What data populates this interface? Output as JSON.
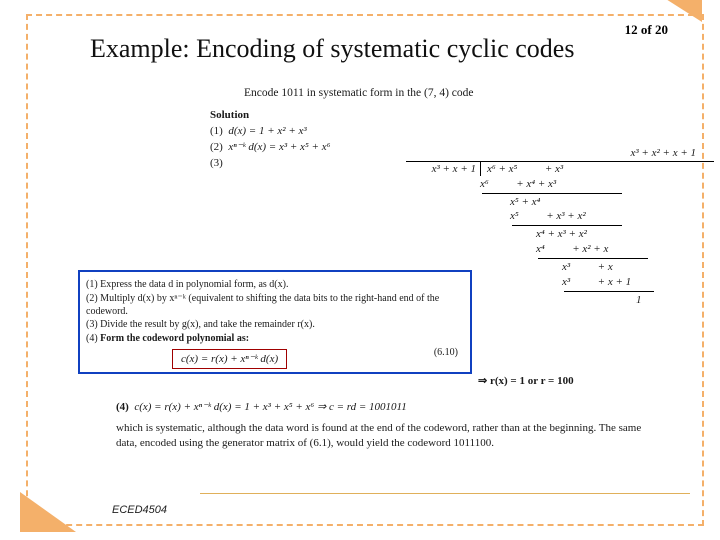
{
  "page_indicator": "12 of 20",
  "title": "Example: Encoding of systematic cyclic codes",
  "task": "Encode 1011 in systematic form in the (7, 4) code",
  "solution": {
    "header": "Solution",
    "line1_label": "(1)",
    "line1_expr": "d(x) = 1 + x² + x³",
    "line2_label": "(2)",
    "line2_expr": "xⁿ⁻ᵏ d(x) = x³ + x⁵ + x⁶",
    "line3_label": "(3)"
  },
  "longdiv": {
    "quotient": "x³ + x² + x + 1",
    "divisor": "x³ + x + 1",
    "dividend": "x⁶ + x⁵    + x³",
    "s1": "x⁶    + x⁴ + x³",
    "r1": "x⁵ + x⁴",
    "s2": "x⁵    + x³ + x²",
    "r2": "x⁴ + x³ + x²",
    "s3": "x⁴    + x² + x",
    "r3": "x³    + x",
    "s4": "x³    + x + 1",
    "final": "1"
  },
  "remainder": "⇒ r(x) = 1  or  r = 100",
  "steps": {
    "s1_label": "(1)",
    "s1": "Express the data d in polynomial form, as d(x).",
    "s2_label": "(2)",
    "s2": "Multiply d(x) by xⁿ⁻ᵏ (equivalent to shifting the data bits to the right-hand end of the codeword.",
    "s3_label": "(3)",
    "s3": "Divide the result by g(x), and take the remainder r(x).",
    "s4_label": "(4)",
    "s4": "Form the codeword polynomial as:",
    "formula": "c(x) = r(x) + xⁿ⁻ᵏ d(x)",
    "eqref": "(6.10)"
  },
  "result": {
    "label": "(4)",
    "expr": "c(x) = r(x) + xⁿ⁻ᵏ d(x) = 1 + x³ + x⁵ + x⁶  ⇒  c = rd = 1001011",
    "desc": "which is systematic, although the data word is found at the end of the codeword, rather than at the beginning. The same data, encoded using the generator matrix of (6.1), would yield the codeword 1011100."
  },
  "course_code": "ECED4504"
}
